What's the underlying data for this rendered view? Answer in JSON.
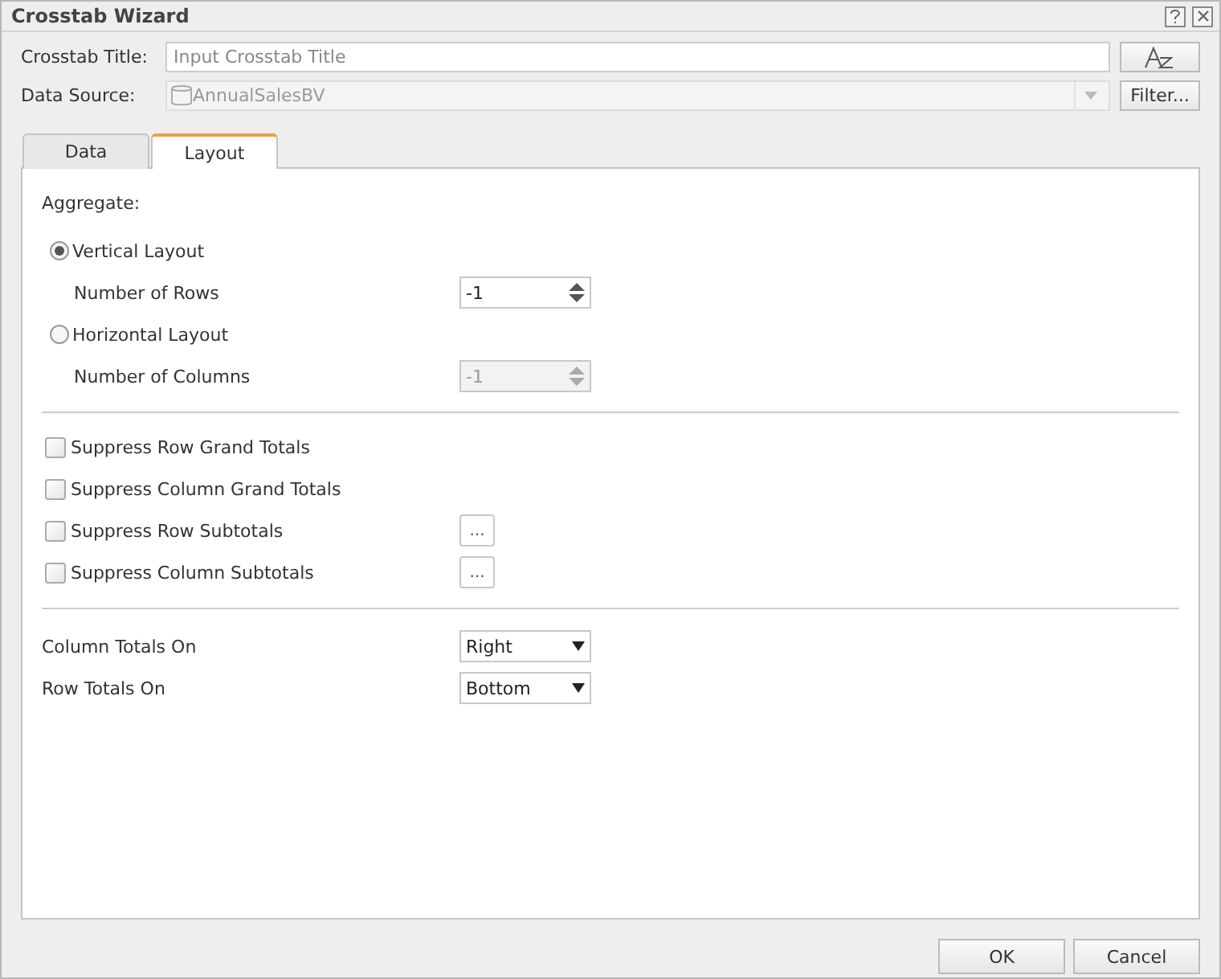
{
  "window": {
    "title": "Crosstab Wizard"
  },
  "title_field": {
    "label": "Crosstab Title:",
    "placeholder": "Input Crosstab Title"
  },
  "data_source": {
    "label": "Data Source:",
    "value": "AnnualSalesBV",
    "disabled": true
  },
  "filter_button": "Filter...",
  "tabs": [
    {
      "label": "Data",
      "selected": false
    },
    {
      "label": "Layout",
      "selected": true
    }
  ],
  "aggregate_label": "Aggregate:",
  "layouts": [
    {
      "label": "Vertical Layout",
      "selected": true,
      "count_label": "Number of Rows",
      "value": "-1"
    },
    {
      "label": "Horizontal Layout",
      "selected": false,
      "count_label": "Number of Columns",
      "value": "-1"
    }
  ],
  "suppress": [
    {
      "label": "Suppress Row Grand Totals",
      "checked": false
    },
    {
      "label": "Suppress Column Grand Totals",
      "checked": false
    },
    {
      "label": "Suppress Row Subtotals",
      "checked": false,
      "more_button": "..."
    },
    {
      "label": "Suppress Column Subtotals",
      "checked": false,
      "more_button": "..."
    }
  ],
  "totals": [
    {
      "label": "Column Totals On",
      "value": "Right"
    },
    {
      "label": "Row Totals On",
      "value": "Bottom"
    }
  ],
  "buttons": [
    "OK",
    "Cancel"
  ]
}
